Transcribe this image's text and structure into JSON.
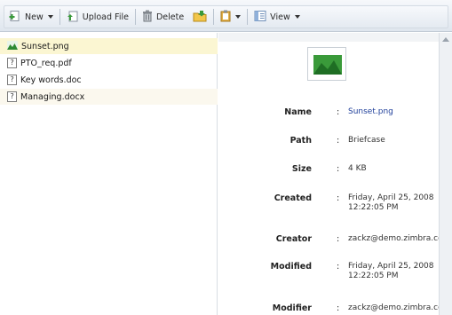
{
  "toolbar": {
    "new_label": "New",
    "upload_label": "Upload File",
    "delete_label": "Delete",
    "view_label": "View",
    "accent": "#3a8a3a"
  },
  "files": [
    {
      "name": "Sunset.png",
      "icon": "image-icon",
      "selected": true
    },
    {
      "name": "PTO_req.pdf",
      "icon": "unknown-file-icon",
      "selected": false
    },
    {
      "name": "Key words.doc",
      "icon": "unknown-file-icon",
      "selected": false
    },
    {
      "name": "Managing.docx",
      "icon": "unknown-file-icon",
      "selected": false
    }
  ],
  "details": {
    "name_label": "Name",
    "name_value": "Sunset.png",
    "path_label": "Path",
    "path_value": "Briefcase",
    "size_label": "Size",
    "size_value": "4 KB",
    "created_label": "Created",
    "created_value_line1": "Friday, April 25, 2008",
    "created_value_line2": "12:22:05 PM",
    "creator_label": "Creator",
    "creator_value": "zackz@demo.zimbra.com",
    "modified_label": "Modified",
    "modified_value_line1": "Friday, April 25, 2008",
    "modified_value_line2": "12:22:05 PM",
    "modifier_label": "Modifier",
    "modifier_value": "zackz@demo.zimbra.com",
    "colon": ":"
  }
}
